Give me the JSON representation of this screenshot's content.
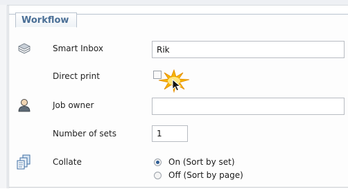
{
  "tab": {
    "label": "Workflow"
  },
  "smart_inbox": {
    "label": "Smart Inbox",
    "value": "Rik",
    "icon": "inbox-tray-icon"
  },
  "direct_print": {
    "label": "Direct print",
    "checked": false
  },
  "job_owner": {
    "label": "Job owner",
    "value": "",
    "icon": "user-icon"
  },
  "number_of_sets": {
    "label": "Number of sets",
    "value": "1"
  },
  "collate": {
    "label": "Collate",
    "icon": "collate-pages-icon",
    "options": [
      {
        "label": "On (Sort by set)",
        "selected": true
      },
      {
        "label": "Off (Sort by page)",
        "selected": false
      }
    ]
  },
  "colors": {
    "tab_text": "#4a6f96",
    "border": "#b9c3cf",
    "highlight": "#f4b000"
  }
}
